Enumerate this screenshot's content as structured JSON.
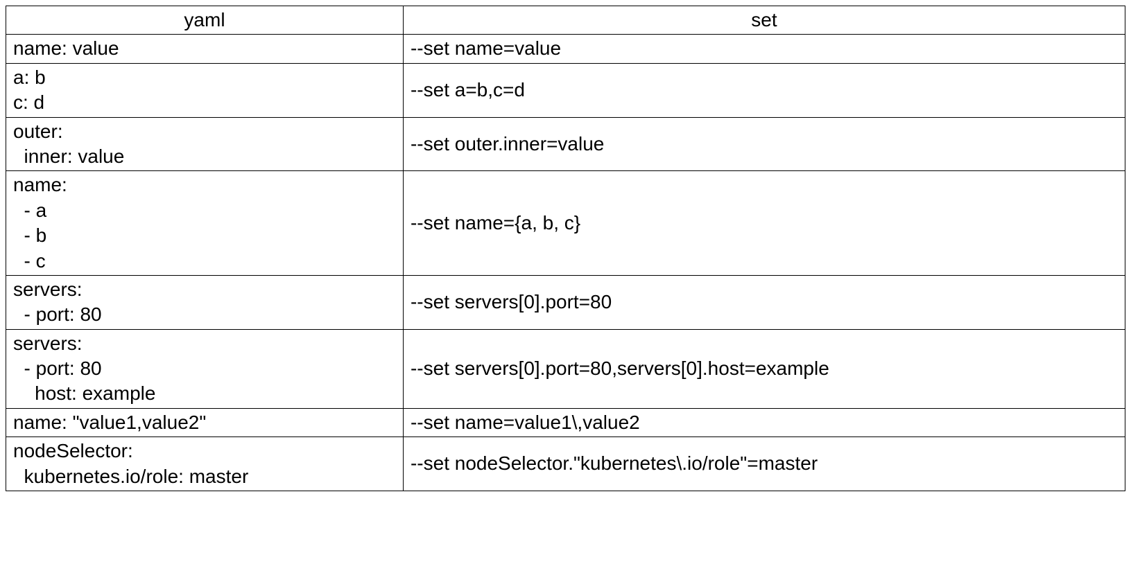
{
  "table": {
    "headers": {
      "yaml": "yaml",
      "set": "set"
    },
    "rows": [
      {
        "yaml": "name: value",
        "set": "--set name=value"
      },
      {
        "yaml": "a: b\nc: d",
        "set": "--set a=b,c=d"
      },
      {
        "yaml": "outer:\n  inner: value",
        "set": "--set outer.inner=value"
      },
      {
        "yaml": "name:\n  - a\n  - b\n  - c",
        "set": "--set name={a, b, c}"
      },
      {
        "yaml": "servers:\n  - port: 80",
        "set": "--set servers[0].port=80"
      },
      {
        "yaml": "servers:\n  - port: 80\n    host: example",
        "set": "--set servers[0].port=80,servers[0].host=example"
      },
      {
        "yaml": "name: \"value1,value2\"",
        "set": "--set name=value1\\,value2"
      },
      {
        "yaml": "nodeSelector:\n  kubernetes.io/role: master",
        "set": "--set nodeSelector.\"kubernetes\\.io/role\"=master"
      }
    ]
  }
}
